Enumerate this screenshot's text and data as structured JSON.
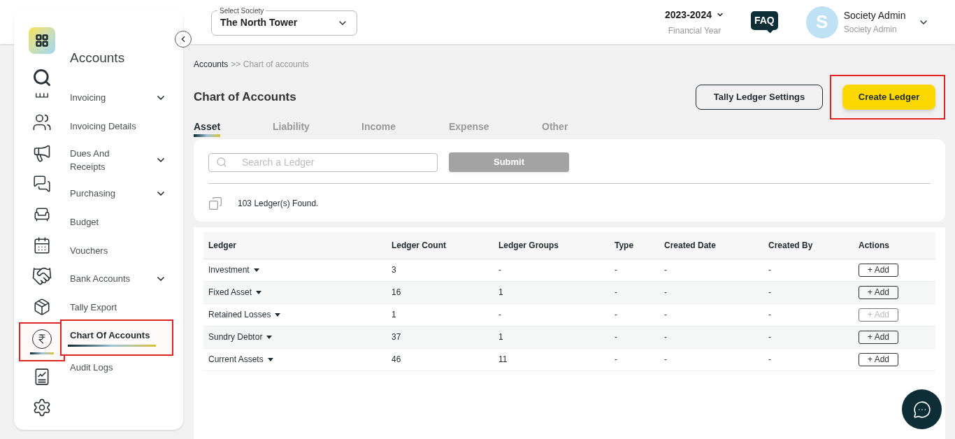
{
  "header": {
    "society_select": {
      "label": "Select Society",
      "value": "The North Tower"
    },
    "year": {
      "value": "2023-2024",
      "caption": "Financial Year"
    },
    "faq": "FAQ",
    "user": {
      "initial": "S",
      "name": "Society Admin",
      "role": "Society Admin"
    }
  },
  "rail": [
    {
      "selected": false,
      "highlighted": false
    },
    {
      "selected": false,
      "highlighted": false
    },
    {
      "selected": false,
      "highlighted": false
    },
    {
      "selected": false,
      "highlighted": false
    },
    {
      "selected": false,
      "highlighted": false
    },
    {
      "selected": false,
      "highlighted": false
    },
    {
      "selected": false,
      "highlighted": false
    },
    {
      "selected": false,
      "highlighted": false
    },
    {
      "selected": false,
      "highlighted": false
    },
    {
      "selected": true,
      "highlighted": true
    },
    {
      "selected": false,
      "highlighted": false
    },
    {
      "selected": false,
      "highlighted": false
    }
  ],
  "menu": {
    "title": "Accounts",
    "items": [
      {
        "label": "Invoicing",
        "submenu": true,
        "selected": false,
        "highlighted": false
      },
      {
        "label": "Invoicing Details",
        "submenu": false,
        "selected": false,
        "highlighted": false
      },
      {
        "label": "Dues And Receipts",
        "submenu": true,
        "selected": false,
        "highlighted": false
      },
      {
        "label": "Purchasing",
        "submenu": true,
        "selected": false,
        "highlighted": false
      },
      {
        "label": "Budget",
        "submenu": false,
        "selected": false,
        "highlighted": false
      },
      {
        "label": "Vouchers",
        "submenu": false,
        "selected": false,
        "highlighted": false
      },
      {
        "label": "Bank Accounts",
        "submenu": true,
        "selected": false,
        "highlighted": false
      },
      {
        "label": "Tally Export",
        "submenu": false,
        "selected": false,
        "highlighted": false
      },
      {
        "label": "Chart Of Accounts",
        "submenu": false,
        "selected": true,
        "highlighted": true
      },
      {
        "label": "Audit Logs",
        "submenu": false,
        "selected": false,
        "highlighted": false
      }
    ]
  },
  "breadcrumb": {
    "link": "Accounts",
    "current": ">> Chart of accounts"
  },
  "page_title": "Chart of Accounts",
  "buttons": [
    {
      "label": "Tally Ledger Settings",
      "kind": "outline",
      "highlighted": false
    },
    {
      "label": "Create Ledger",
      "kind": "primary",
      "highlighted": true
    }
  ],
  "tabs": [
    {
      "label": "Asset",
      "selected": true
    },
    {
      "label": "Liability",
      "selected": false
    },
    {
      "label": "Income",
      "selected": false
    },
    {
      "label": "Expense",
      "selected": false
    },
    {
      "label": "Other",
      "selected": false
    }
  ],
  "search": {
    "placeholder": "Search a Ledger",
    "submit": "Submit"
  },
  "found": {
    "count": "103",
    "text": "Ledger(s) Found."
  },
  "table": {
    "columns": [
      "Ledger",
      "Ledger Count",
      "Ledger Groups",
      "Type",
      "Created Date",
      "Created By",
      "Actions"
    ],
    "rows": [
      {
        "ledger": "Investment",
        "count": "3",
        "groups": "-",
        "type": "-",
        "created_date": "-",
        "created_by": "-",
        "action": "+ Add",
        "disabled": false
      },
      {
        "ledger": "Fixed Asset",
        "count": "16",
        "groups": "1",
        "type": "-",
        "created_date": "-",
        "created_by": "-",
        "action": "+ Add",
        "disabled": false
      },
      {
        "ledger": "Retained Losses",
        "count": "1",
        "groups": "-",
        "type": "-",
        "created_date": "-",
        "created_by": "-",
        "action": "+ Add",
        "disabled": true
      },
      {
        "ledger": "Sundry Debtor",
        "count": "37",
        "groups": "1",
        "type": "-",
        "created_date": "-",
        "created_by": "-",
        "action": "+ Add",
        "disabled": false
      },
      {
        "ledger": "Current Assets",
        "count": "46",
        "groups": "11",
        "type": "-",
        "created_date": "-",
        "created_by": "-",
        "action": "+ Add",
        "disabled": false
      }
    ]
  }
}
